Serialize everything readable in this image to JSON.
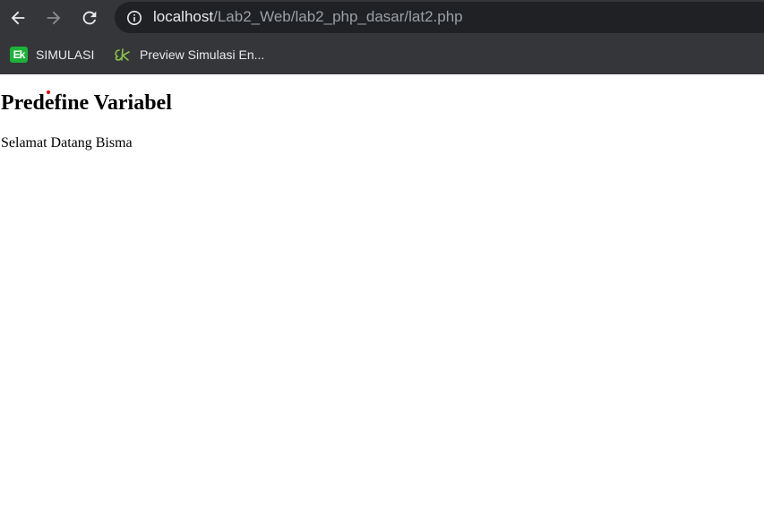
{
  "browser": {
    "url_host": "localhost",
    "url_path": "/Lab2_Web/lab2_php_dasar/lat2.php",
    "colors": {
      "chrome_bg": "#35363a",
      "omnibox_bg": "#202124",
      "url_host": "#e8eaed",
      "url_path": "#9aa0a6",
      "bookmark_ek_green": "#1db23a"
    },
    "icons": {
      "back": "back-arrow-icon",
      "forward": "forward-arrow-icon",
      "reload": "reload-icon",
      "site_info": "info-icon"
    }
  },
  "bookmarks": [
    {
      "icon_text": "Ek",
      "label": "SIMULASI",
      "icon": "ek-favicon"
    },
    {
      "icon_text": "",
      "label": "Preview Simulasi En...",
      "icon": "ek-script-favicon"
    }
  ],
  "page": {
    "heading": "Predefine Variabel",
    "text": "Selamat Datang Bisma",
    "cursor_color": "#e00000"
  }
}
